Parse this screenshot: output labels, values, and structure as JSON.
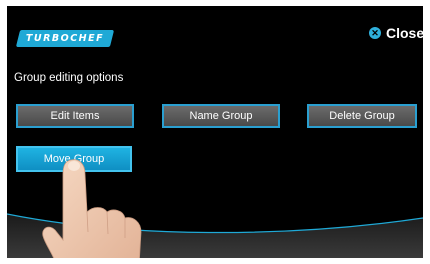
{
  "brand": {
    "logo_text": "TURBOCHEF"
  },
  "header": {
    "close_label": "Close",
    "close_icon": "close-circle-icon"
  },
  "section": {
    "title": "Group editing options"
  },
  "buttons": {
    "edit_items": "Edit Items",
    "name_group": "Name Group",
    "delete_group": "Delete Group",
    "move_group": "Move Group"
  },
  "colors": {
    "accent": "#1fa9d6",
    "button_gray": "#5a5a5a",
    "button_active": "#16a4d8",
    "background": "#000000"
  }
}
